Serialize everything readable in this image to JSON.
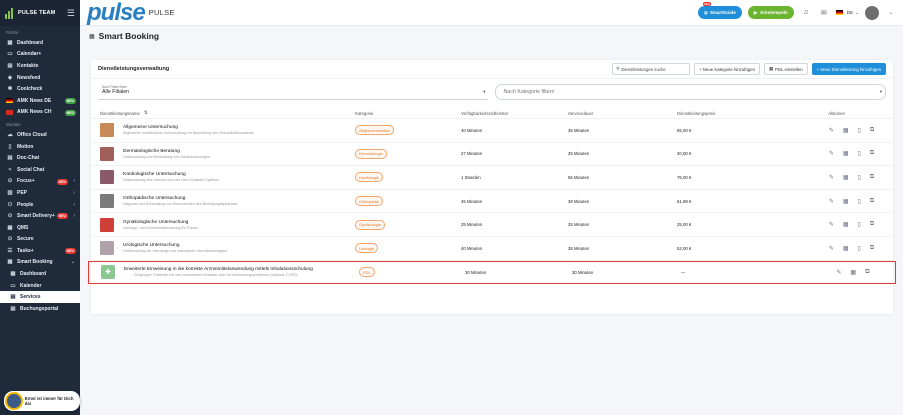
{
  "sidebar": {
    "team": "PULSE TEAM",
    "section1": "Portal",
    "items1": [
      {
        "icon": "▦",
        "label": "Dashboard",
        "name": "sidebar-item-dashboard"
      },
      {
        "icon": "▭",
        "label": "Calendar+",
        "name": "sidebar-item-calendar"
      },
      {
        "icon": "▤",
        "label": "Kontakte",
        "name": "sidebar-item-kontakte"
      },
      {
        "icon": "◈",
        "label": "Newsfeed",
        "name": "sidebar-item-newsfeed"
      },
      {
        "icon": "✱",
        "label": "Coolcheck",
        "name": "sidebar-item-coolcheck"
      },
      {
        "icon": "flag-de",
        "label": "AMK News DE",
        "badge": "NEU",
        "name": "sidebar-item-amk-de"
      },
      {
        "icon": "flag-ch",
        "label": "AMK News CH",
        "badge": "NEU",
        "name": "sidebar-item-amk-ch"
      }
    ],
    "section2": "Module",
    "items2": [
      {
        "icon": "☁",
        "label": "Office Cloud",
        "name": "sidebar-item-office-cloud"
      },
      {
        "icon": "▯",
        "label": "Motion",
        "name": "sidebar-item-motion"
      },
      {
        "icon": "▤",
        "label": "Doc-Chat",
        "name": "sidebar-item-doc-chat"
      },
      {
        "icon": "<",
        "label": "Social Chat",
        "name": "sidebar-item-social-chat"
      },
      {
        "icon": "⊙",
        "label": "Focus+",
        "badge": "NEU",
        "chev": "›",
        "name": "sidebar-item-focus"
      },
      {
        "icon": "▥",
        "label": "PEP",
        "chev": "›",
        "name": "sidebar-item-pep"
      },
      {
        "icon": "⚇",
        "label": "People",
        "chev": "›",
        "name": "sidebar-item-people"
      },
      {
        "icon": "⊙",
        "label": "Smart Delivery+",
        "badge": "NEU",
        "chev": "›",
        "name": "sidebar-item-smart-delivery"
      },
      {
        "icon": "▦",
        "label": "QMS",
        "name": "sidebar-item-qms"
      },
      {
        "icon": "⊙",
        "label": "Secure",
        "name": "sidebar-item-secure"
      },
      {
        "icon": "☰",
        "label": "Tasks+",
        "badge": "NEU",
        "name": "sidebar-item-tasks"
      },
      {
        "icon": "▦",
        "label": "Smart Booking",
        "chev": "⌄",
        "name": "sidebar-item-smart-booking"
      }
    ],
    "sub_items": [
      {
        "icon": "▦",
        "label": "Dashboard",
        "name": "sidebar-subitem-dashboard"
      },
      {
        "icon": "▭",
        "label": "Kalender",
        "name": "sidebar-subitem-kalender"
      },
      {
        "icon": "▤",
        "label": "Services",
        "active": true,
        "name": "sidebar-subitem-services"
      },
      {
        "icon": "▤",
        "label": "Buchungsportal",
        "name": "sidebar-subitem-buchungsportal"
      }
    ],
    "toast": "Ernst ist immer für Dich da!"
  },
  "topbar": {
    "brand": "pulse",
    "brand_sub": "PULSE",
    "new_badge": "Neu",
    "smartguide": "SmartGuide",
    "einstempeln": "Einstempeln",
    "lang": "DE"
  },
  "page": {
    "title": "Smart Booking"
  },
  "card": {
    "title": "Dienstleistungsverwaltung",
    "search_placeholder": "Dienstleistungen suche",
    "btn_kategorie": "+ Neue Kategorie hinzufügen",
    "btn_pdl": "PDL einstellen",
    "btn_neu": "+ Neue Dienstleistung hinzufügen",
    "filter_label": "Nach Filiale filtern",
    "filter_value": "Alle Filialen",
    "category_placeholder": "Nach Kategorie filtern"
  },
  "table": {
    "headers": [
      "Dienstleistungsname",
      "Kategorie",
      "Verfügbarkeitszeitfenster",
      "Servicedauer",
      "Dienstleistungspreis",
      "Aktionen"
    ],
    "rows": [
      {
        "name": "Allgemeine Untersuchung",
        "desc": "Allgemeine medizinische Untersuchung zur Beurteilung des Gesundheitszustands",
        "category": "Allgemeinmedizin",
        "window": "40 Minuten",
        "duration": "35 Minuten",
        "price": "55,00 €",
        "color": "#c98a5a"
      },
      {
        "name": "Dermatologische Beratung",
        "desc": "Untersuchung und Behandlung von Hauterkrankungen",
        "category": "Dermatologie",
        "window": "27 Minuten",
        "duration": "25 Minuten",
        "price": "20,00 €",
        "color": "#a0605a"
      },
      {
        "name": "Kardiologische Untersuchung",
        "desc": "Untersuchung des Herzens und des Herz-Kreislauf-Systems",
        "category": "Kardiologie",
        "window": "1 Stunden",
        "duration": "55 Minuten",
        "price": "75,00 €",
        "color": "#8a5a6a"
      },
      {
        "name": "Orthopädische Untersuchung",
        "desc": "Diagnose und Behandlung von Beschwerden des Bewegungsapparates",
        "category": "Orthopädie",
        "window": "45 Minuten",
        "duration": "38 Minuten",
        "price": "61,99 €",
        "color": "#7a7a7a"
      },
      {
        "name": "Gynäkologische Untersuchung",
        "desc": "Vorsorge- und Kontrolluntersuchung für Frauen",
        "category": "Gynäkologie",
        "window": "25 Minuten",
        "duration": "25 Minuten",
        "price": "25,00 €",
        "color": "#d0403a"
      },
      {
        "name": "Urologische Untersuchung",
        "desc": "Untersuchung der Harnwege und männlichen Geschlechtsorgane",
        "category": "Urologie",
        "window": "40 Minuten",
        "duration": "35 Minuten",
        "price": "52,00 €",
        "color": "#b0a0a8"
      }
    ],
    "hl_row": {
      "name": "Erweiterte Einweisung in die korrekte Arzneimittelanwendung mittels Inhalationsschulung",
      "bullet": "◦ Zielgruppe: Patienten mit neu verordnetem Inhalator oder bei Anwendungsproblemen (Asthma, COPD)",
      "category": "PDL",
      "window": "30 Minuten",
      "duration": "30 Minuten",
      "price": "—"
    }
  }
}
